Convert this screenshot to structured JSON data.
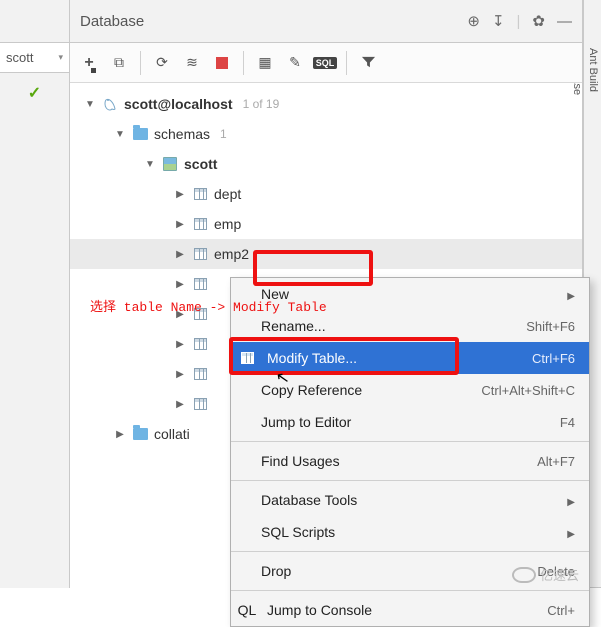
{
  "left": {
    "user_tab": "scott",
    "check": "✓"
  },
  "panel": {
    "title": "Database",
    "title_icons": {
      "target": "⊕",
      "down": "↧",
      "gear": "✿",
      "minus": "—"
    },
    "toolbar": {
      "add": "+",
      "copy": "⧉",
      "refresh": "⟳",
      "query": "≋",
      "stop": "",
      "grid": "▦",
      "edit": "✎",
      "sql": "SQL",
      "filter": "▾"
    }
  },
  "right_rail": {
    "tab1": "Ant Build",
    "tab2": "Database"
  },
  "tree": {
    "conn_label": "scott@localhost",
    "conn_count": "1 of 19",
    "schemas_label": "schemas",
    "schemas_count": "1",
    "schema_name": "scott",
    "tables": [
      "dept",
      "emp",
      "emp2"
    ],
    "hidden_rows": 5,
    "collations_label": "collati"
  },
  "annotation": "选择 table Name -> Modify Table",
  "ctx": {
    "items": [
      {
        "label": "New",
        "u": "N",
        "shortcut": "",
        "sub": true
      },
      {
        "label": "Rename...",
        "u": "R",
        "shortcut": "Shift+F6"
      },
      {
        "label": "Modify Table...",
        "u": "M",
        "shortcut": "Ctrl+F6",
        "highlight": true,
        "icon": "table"
      },
      {
        "label": "Copy Reference",
        "u": "",
        "shortcut": "Ctrl+Alt+Shift+C"
      },
      {
        "label": "Jump to Editor",
        "u": "J",
        "shortcut": "F4"
      }
    ],
    "group2": [
      {
        "label": "Find Usages",
        "u": "F",
        "shortcut": "Alt+F7"
      }
    ],
    "group3": [
      {
        "label": "Database Tools",
        "u": "",
        "shortcut": "",
        "sub": true
      },
      {
        "label": "SQL Scripts",
        "u": "",
        "shortcut": "",
        "sub": true
      }
    ],
    "group4": [
      {
        "label": "Drop",
        "u": "D",
        "shortcut": "Delete"
      }
    ],
    "group5": [
      {
        "label": "Jump to Console",
        "u": "",
        "shortcut": "Ctrl+",
        "icon": "sql"
      }
    ]
  },
  "watermark": "亿速云"
}
